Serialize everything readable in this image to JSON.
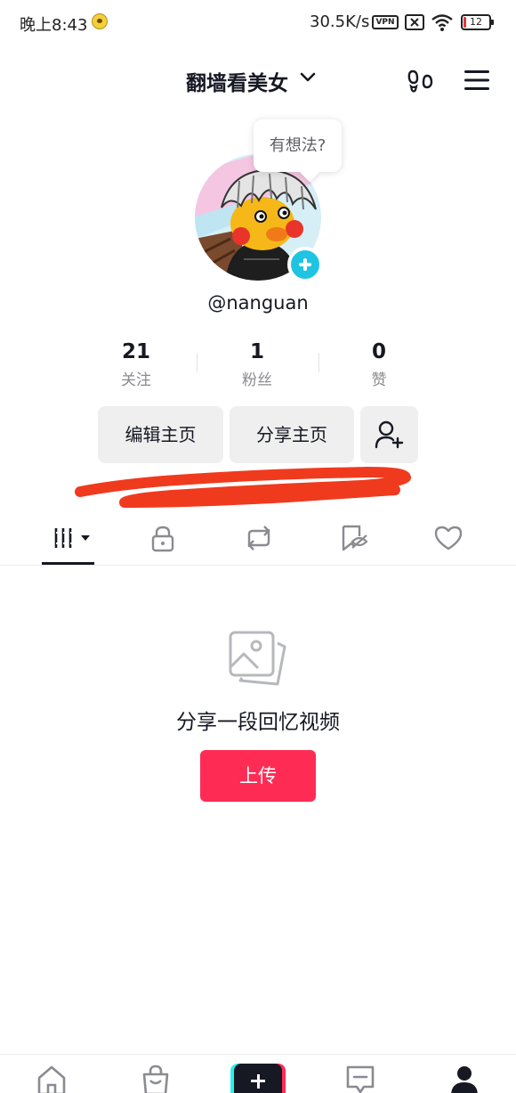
{
  "status_bar": {
    "time": "晚上8:43",
    "network_speed": "30.5K/s",
    "vpn": "VPN",
    "battery": "12"
  },
  "header": {
    "title": "翻墙看美女"
  },
  "profile": {
    "bubble_text": "有想法?",
    "username": "@nanguan",
    "stats": [
      {
        "value": "21",
        "label": "关注"
      },
      {
        "value": "1",
        "label": "粉丝"
      },
      {
        "value": "0",
        "label": "赞"
      }
    ],
    "buttons": {
      "edit": "编辑主页",
      "share": "分享主页"
    }
  },
  "tabs": [
    "works",
    "private",
    "reposts",
    "collections",
    "likes"
  ],
  "empty_state": {
    "message": "分享一段回忆视频",
    "upload_label": "上传"
  },
  "bottom_nav": [
    "home",
    "shop",
    "create",
    "inbox",
    "profile"
  ],
  "colors": {
    "accent": "#fe2c55",
    "cyan": "#20c4e3",
    "redaction": "#f03a1e"
  }
}
